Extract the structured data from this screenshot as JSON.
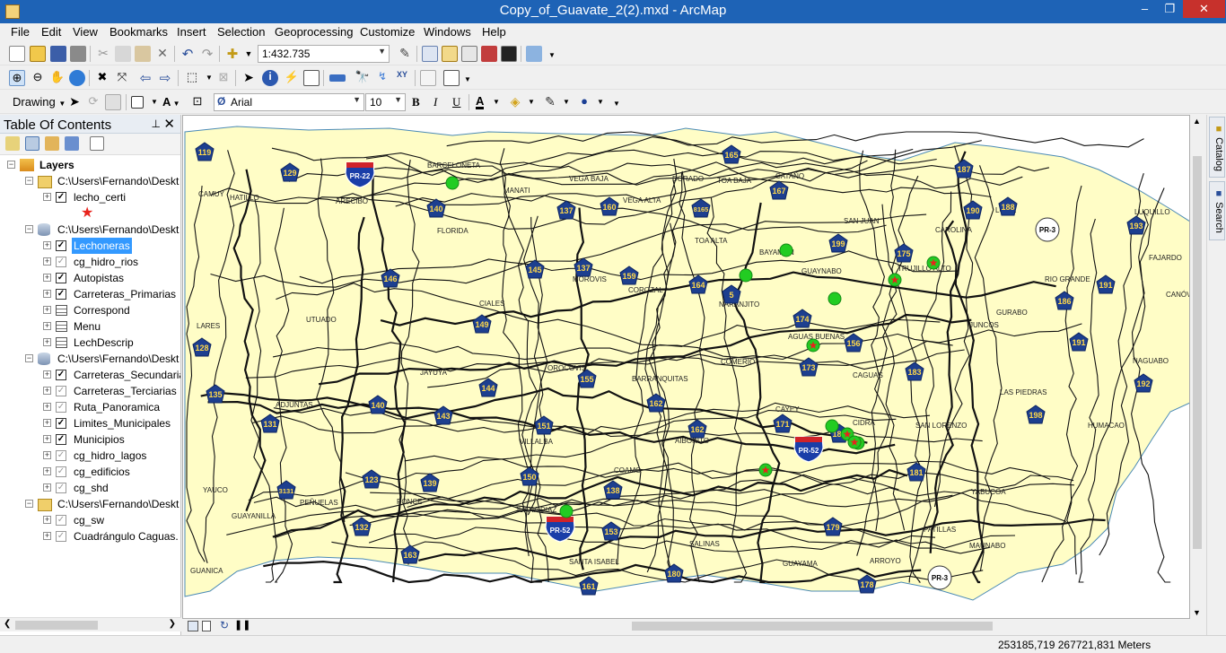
{
  "window": {
    "title": "Copy_of_Guavate_2(2).mxd - ArcMap",
    "minimize": "–",
    "maximize": "❐",
    "close": "✕"
  },
  "menu": [
    "File",
    "Edit",
    "View",
    "Bookmarks",
    "Insert",
    "Selection",
    "Geoprocessing",
    "Customize",
    "Windows",
    "Help"
  ],
  "toolbar": {
    "scale": "1:432.735",
    "drawing_label": "Drawing",
    "text_tool": "A",
    "font_name": "Arial",
    "font_size": "10",
    "bold": "B",
    "italic": "I",
    "underline": "U",
    "font_color": "A"
  },
  "toc": {
    "title": "Table Of Contents",
    "pin": "⊥",
    "close": "✕",
    "items": [
      {
        "label": "Layers",
        "type": "root",
        "level": 0
      },
      {
        "label": "C:\\Users\\Fernando\\Deskt",
        "type": "folder",
        "level": 1
      },
      {
        "label": "lecho_certi",
        "type": "layer",
        "level": 2,
        "checked": true
      },
      {
        "label": "★",
        "type": "symbol",
        "level": 3
      },
      {
        "label": "C:\\Users\\Fernando\\Deskt",
        "type": "db",
        "level": 1
      },
      {
        "label": "Lechoneras",
        "type": "layer",
        "level": 2,
        "checked": true,
        "selected": true
      },
      {
        "label": "cg_hidro_rios",
        "type": "layer",
        "level": 2,
        "checked": false
      },
      {
        "label": "Autopistas",
        "type": "layer",
        "level": 2,
        "checked": true
      },
      {
        "label": "Carreteras_Primarias",
        "type": "layer",
        "level": 2,
        "checked": true
      },
      {
        "label": "Correspond",
        "type": "table",
        "level": 2
      },
      {
        "label": "Menu",
        "type": "table",
        "level": 2
      },
      {
        "label": "LechDescrip",
        "type": "table",
        "level": 2
      },
      {
        "label": "C:\\Users\\Fernando\\Deskt",
        "type": "db",
        "level": 1
      },
      {
        "label": "Carreteras_Secundaria",
        "type": "layer",
        "level": 2,
        "checked": true
      },
      {
        "label": "Carreteras_Terciarias",
        "type": "layer",
        "level": 2,
        "checked": false
      },
      {
        "label": "Ruta_Panoramica",
        "type": "layer",
        "level": 2,
        "checked": false
      },
      {
        "label": "Limites_Municipales",
        "type": "layer",
        "level": 2,
        "checked": true
      },
      {
        "label": "Municipios",
        "type": "layer",
        "level": 2,
        "checked": true
      },
      {
        "label": "cg_hidro_lagos",
        "type": "layer",
        "level": 2,
        "checked": false
      },
      {
        "label": "cg_edificios",
        "type": "layer",
        "level": 2,
        "checked": false
      },
      {
        "label": "cg_shd",
        "type": "layer",
        "level": 2,
        "checked": false
      },
      {
        "label": "C:\\Users\\Fernando\\Deskt",
        "type": "folder",
        "level": 1
      },
      {
        "label": "cg_sw",
        "type": "layer",
        "level": 2,
        "checked": false
      },
      {
        "label": "Cuadrángulo Caguas.",
        "type": "layer",
        "level": 2,
        "checked": false
      }
    ]
  },
  "map": {
    "towns": [
      "BARCELONETA",
      "CAMUY",
      "HATILLO",
      "ARECIBO",
      "MANATI",
      "VEGA BAJA",
      "VEGA ALTA",
      "DORADO",
      "TOA BAJA",
      "CATAÑO",
      "FLORIDA",
      "TOA ALTA",
      "BAYAMÓN",
      "GUAYNABO",
      "SAN JUAN",
      "TRUJILLO ALTO",
      "CAROLINA",
      "LOIZA",
      "RIO GRANDE",
      "LUQUILLO",
      "FAJARDO",
      "CANÓVANAS",
      "GURABO",
      "JUNCOS",
      "NAGUABO",
      "LAS PIEDRAS",
      "HUMACAO",
      "SAN LORENZO",
      "YABUCOA",
      "MAUNABO",
      "PATILLAS",
      "ARROYO",
      "GUAYAMA",
      "SALINAS",
      "SANTA ISABEL",
      "JUANA DIAZ",
      "COAMO",
      "VILLALBA",
      "PONCE",
      "PEÑUELAS",
      "GUAYANILLA",
      "GUANICA",
      "YAUCO",
      "ADJUNTAS",
      "JAYUYA",
      "UTUADO",
      "LARES",
      "CIALES",
      "MOROVIS",
      "COROZAL",
      "NARANJITO",
      "COMERIO",
      "AGUAS BUENAS",
      "CAGUAS",
      "CIDRA",
      "CAYEY",
      "AIBONITO",
      "BARRANQUITAS",
      "OROCOVIS"
    ],
    "route_shields": [
      "119",
      "129",
      "140",
      "137",
      "160",
      "8165",
      "165",
      "167",
      "187",
      "188",
      "190",
      "199",
      "175",
      "193",
      "146",
      "145",
      "137",
      "159",
      "164",
      "5",
      "174",
      "156",
      "191",
      "186",
      "149",
      "173",
      "183",
      "191",
      "192",
      "144",
      "155",
      "128",
      "135",
      "131",
      "140",
      "143",
      "162",
      "162",
      "171",
      "184",
      "198",
      "151",
      "150",
      "138",
      "123",
      "139",
      "3131",
      "132",
      "153",
      "163",
      "161",
      "180",
      "179",
      "178",
      "181"
    ],
    "highways": [
      "PR-22",
      "PR-52",
      "PR-52"
    ],
    "secondary_routes": [
      "PR-3",
      "PR-3"
    ]
  },
  "sidebar": {
    "catalog": "Catalog",
    "search": "Search"
  },
  "status": {
    "coordinates": "253185,719  267721,831 Meters"
  },
  "colors": {
    "titlebar": "#1e63b6",
    "land": "#fffdc6",
    "shield": "#1d3f8f",
    "lechonera": "#22cc22",
    "star": "#e8231c"
  }
}
